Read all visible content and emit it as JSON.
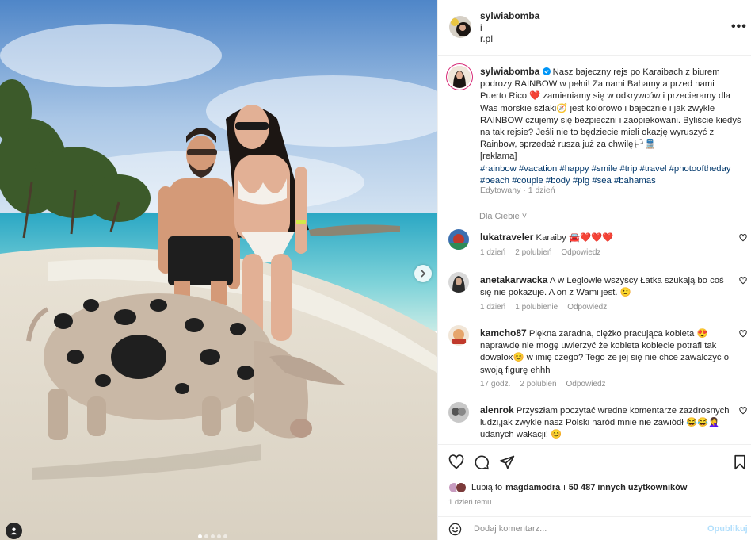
{
  "post": {
    "author": "sylwiabomba",
    "header_separator": "i",
    "header_collaborator": "r.pl",
    "more_label": "•••",
    "caption_text": "Nasz bajeczny rejs po Karaibach z biurem podrozy RAINBOW w pełni! Za nami Bahamy a przed nami Puerto Rico ❤️ zamieniamy się w odkrywców i przecieramy dla Was morskie szlaki🧭 jest kolorowo i bajecznie i jak zwykle RAINBOW czujemy się bezpieczni i zaopiekowani. Byliście kiedyś na tak rejsie? Jeśli nie to będziecie mieli okazję wyruszyć z Rainbow, sprzedaż rusza już za chwilę🏳🚆",
    "caption_ad": "[reklama]",
    "hashtags": "#rainbow #vacation #happy #smile #trip #travel #photooftheday #beach #couple #body #pig #sea #bahamas",
    "edited": "Edytowany · 1 dzień",
    "for_you": "Dla Ciebie ˅"
  },
  "comments": [
    {
      "user": "lukatraveler",
      "text": "Karaiby 🚘❤️❤️❤️",
      "time": "1 dzień",
      "likes": "2 polubień",
      "reply": "Odpowiedz"
    },
    {
      "user": "anetakarwacka",
      "text": "A w Legiowie wszyscy Łatka szukają bo coś się nie pokazuje. A on z Wami jest. 🙂",
      "time": "1 dzień",
      "likes": "1 polubienie",
      "reply": "Odpowiedz"
    },
    {
      "user": "kamcho87",
      "text": "Piękna zaradna, ciężko pracująca kobieta 😍 naprawdę nie mogę uwierzyć że kobieta kobiecie potrafi tak dowalox😊 w imię czego? Tego że jej się nie chce zawalczyć o swoją figurę ehhh",
      "time": "17 godz.",
      "likes": "2 polubień",
      "reply": "Odpowiedz"
    },
    {
      "user": "alenrok",
      "text": "Przyszłam poczytać wredne komentarze zazdrosnych ludzi,jak zwykle nasz Polski naród mnie nie zawiódł 😂😂🤦‍♀️ udanych wakacji! 😊",
      "time": "",
      "likes": "",
      "reply": ""
    }
  ],
  "likes": {
    "prefix": "Lubią to",
    "user": "magdamodra",
    "middle": "i",
    "count": "50 487 innych użytkowników"
  },
  "timestamp": "1 dzień temu",
  "composer": {
    "placeholder": "Dodaj komentarz...",
    "publish": "Opublikuj"
  },
  "carousel": {
    "slides": 5,
    "active_index": 0
  },
  "colors": {
    "link": "#00376b",
    "text": "#262626",
    "muted": "#8e8e8e",
    "verified": "#0095f6",
    "publish_disabled": "#b2dffc"
  },
  "icons": [
    "heart-icon",
    "comment-icon",
    "share-icon",
    "bookmark-icon",
    "emoji-icon",
    "chevron-right-icon",
    "user-tag-icon",
    "more-icon",
    "verified-icon"
  ]
}
